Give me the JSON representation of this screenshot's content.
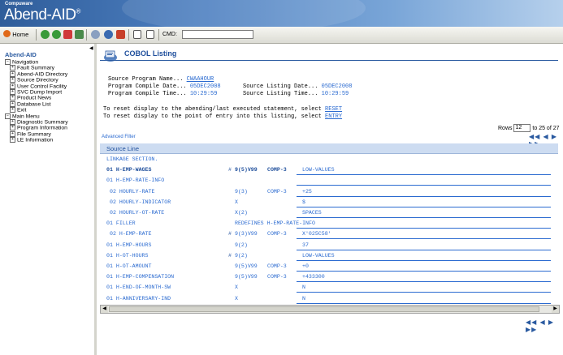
{
  "app": {
    "company": "Compuware",
    "name": "Abend-AID",
    "reg": "®"
  },
  "toolbar": {
    "home_label": "Home",
    "cmd_label": "CMD:",
    "cmd_value": ""
  },
  "nav": {
    "title": "Abend-AID",
    "items": [
      {
        "label": "Navigation",
        "box": "−",
        "level": 0
      },
      {
        "label": "Fault Summary",
        "box": "+",
        "level": 1
      },
      {
        "label": "Abend-AID Directory",
        "box": "+",
        "level": 1
      },
      {
        "label": "Source Directory",
        "box": "+",
        "level": 1
      },
      {
        "label": "User Control Facility",
        "box": "+",
        "level": 1
      },
      {
        "label": "SVC Dump Import",
        "box": "+",
        "level": 1
      },
      {
        "label": "Product News",
        "box": "+",
        "level": 1
      },
      {
        "label": "Database List",
        "box": "+",
        "level": 1
      },
      {
        "label": "Exit",
        "box": "+",
        "level": 1
      },
      {
        "label": "Main Menu",
        "box": "−",
        "level": 0
      },
      {
        "label": "Diagnostic Summary",
        "box": "+",
        "level": 1
      },
      {
        "label": "Program Information",
        "box": "+",
        "level": 1
      },
      {
        "label": "File Summary",
        "box": "+",
        "level": 1
      },
      {
        "label": "LE Information",
        "box": "+",
        "level": 1
      }
    ]
  },
  "main": {
    "title": "COBOL Listing",
    "source_program_label": "Source Program Name...",
    "source_program_value": "CWAAHOUR",
    "compile_date_label": "Program Compile Date...",
    "compile_date_value": "05DEC2008",
    "compile_time_label": "Program Compile Time...",
    "compile_time_value": "10:29:59",
    "listing_date_label": "Source Listing Date...",
    "listing_date_value": "05DEC2008",
    "listing_time_label": "Source Listing Time...",
    "listing_time_value": "10:29:59",
    "reset_text": "To reset display to the abending/last executed statement, select",
    "reset_link": "RESET",
    "entry_text": "To reset display to the point of entry into this listing, select",
    "entry_link": "ENTRY",
    "advanced_filter": "Advanced Filter",
    "rows_label": "Rows",
    "rows_value": "12",
    "rows_range": "to 25 of 27",
    "pager_top": "◀◀ ◀ ▶ ▶▶",
    "pager_bottom": "◀◀ ◀ ▶ ▶▶",
    "grid_header": "Source Line"
  },
  "rows": [
    {
      "name": "LINKAGE SECTION.",
      "hash": "",
      "pic": "",
      "usage": "",
      "value": ""
    },
    {
      "name": "01 H-EMP-WAGES",
      "hash": "#",
      "pic": "9(5)V99",
      "usage": "COMP-3",
      "value": "LOW-VALUES",
      "bold": true
    },
    {
      "name": "01 H-EMP-RATE-INFO",
      "hash": "",
      "pic": "",
      "usage": "",
      "value": ""
    },
    {
      "name": "02 HOURLY-RATE",
      "hash": "",
      "pic": "9(3)",
      "usage": "COMP-3",
      "value": "+25"
    },
    {
      "name": "02 HOURLY-INDICATOR",
      "hash": "",
      "pic": "X",
      "usage": "",
      "value": "$"
    },
    {
      "name": "02 HOURLY-OT-RATE",
      "hash": "",
      "pic": "X(2)",
      "usage": "",
      "value": "SPACES"
    },
    {
      "name": "01 FILLER",
      "hash": "",
      "pic": "REDEFINES H-EMP-RATE-INFO",
      "usage": "",
      "value": ""
    },
    {
      "name": "02 H-EMP-RATE",
      "hash": "#",
      "pic": "9(3)V99",
      "usage": "COMP-3",
      "value": "X'025C58'"
    },
    {
      "name": "01 H-EMP-HOURS",
      "hash": "",
      "pic": "9(2)",
      "usage": "",
      "value": "37"
    },
    {
      "name": "01 H-OT-HOURS",
      "hash": "#",
      "pic": "9(2)",
      "usage": "",
      "value": "LOW-VALUES"
    },
    {
      "name": "01 H-OT-AMOUNT",
      "hash": "",
      "pic": "9(5)V99",
      "usage": "COMP-3",
      "value": "+0"
    },
    {
      "name": "01 H-EMP-COMPENSATION",
      "hash": "",
      "pic": "9(5)V99",
      "usage": "COMP-3",
      "value": "+433300"
    },
    {
      "name": "01 H-END-OF-MONTH-SW",
      "hash": "",
      "pic": "X",
      "usage": "",
      "value": "N"
    },
    {
      "name": "01 H-ANNIVERSARY-IND",
      "hash": "",
      "pic": "X",
      "usage": "",
      "value": "N"
    }
  ]
}
